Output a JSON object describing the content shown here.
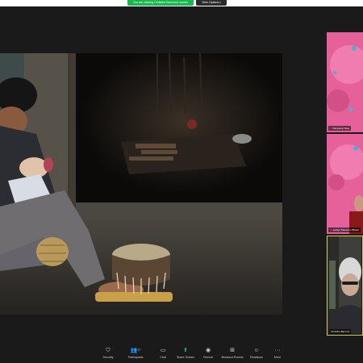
{
  "window": {
    "background": "#1a1a1a"
  },
  "top_bar": {
    "share_banner": "You are viewing Christine Barrons's screen",
    "view_options": "View Options"
  },
  "shared_screen": {
    "content": "photograph of a mother cradling a baby in a dark doorway beside a woven drum"
  },
  "participants": [
    {
      "name": "Dangqing Yang",
      "muted": true
    },
    {
      "name": "Joellyn Peterson-Pflaum",
      "muted": true
    },
    {
      "name": "Christine Barrons",
      "muted": false,
      "active_speaker": true
    }
  ],
  "toolbar": {
    "items": [
      {
        "icon": "shield-icon",
        "label": "Security"
      },
      {
        "icon": "participants-icon",
        "label": "Participants",
        "count": "17"
      },
      {
        "icon": "chat-icon",
        "label": "Chat"
      },
      {
        "icon": "share-screen-icon",
        "label": "Share Screen"
      },
      {
        "icon": "record-icon",
        "label": "Record"
      },
      {
        "icon": "breakout-rooms-icon",
        "label": "Breakout Rooms"
      },
      {
        "icon": "reactions-icon",
        "label": "Reactions"
      },
      {
        "icon": "more-icon",
        "label": "More"
      }
    ]
  },
  "colors": {
    "accent_green": "#16b84f",
    "active_speaker_border": "#d8d22a"
  }
}
